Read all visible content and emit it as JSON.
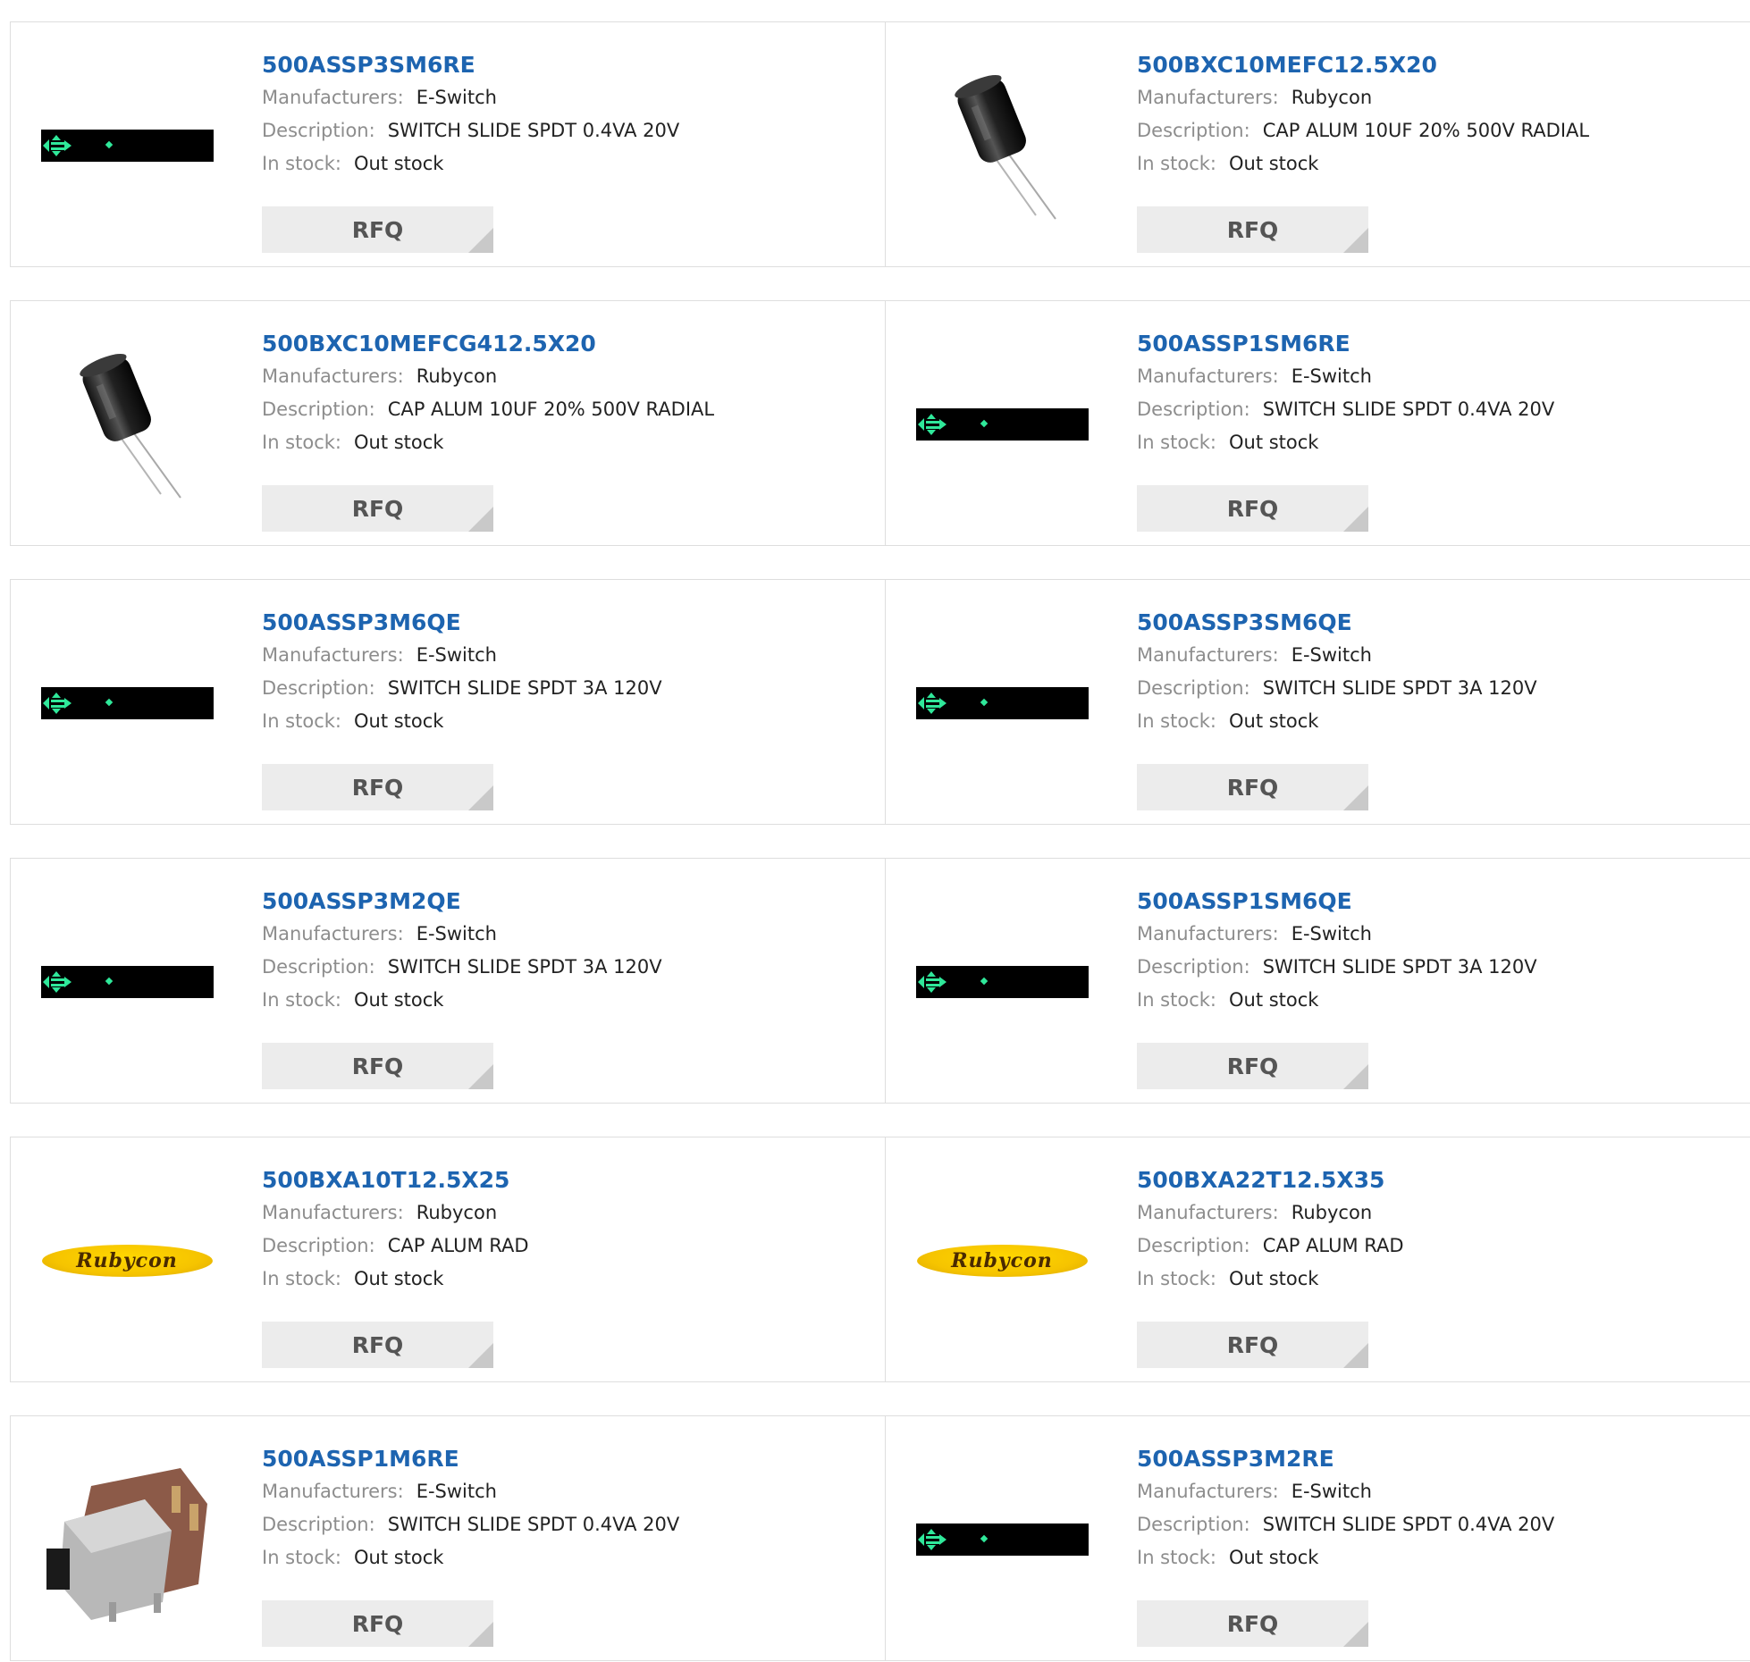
{
  "labels": {
    "manufacturers": "Manufacturers:",
    "description": "Description:",
    "in_stock": "In stock:",
    "rfq": "RFQ"
  },
  "colors": {
    "part_number": "#1d64b0",
    "label": "#8d8d8d",
    "button_bg": "#ececec",
    "border": "#dedede"
  },
  "products": [
    {
      "part": "500ASSP3SM6RE",
      "manufacturer": "E-Switch",
      "description": "SWITCH SLIDE SPDT 0.4VA 20V",
      "stock": "Out stock",
      "image": "switch-strip"
    },
    {
      "part": "500BXC10MEFC12.5X20",
      "manufacturer": "Rubycon",
      "description": "CAP ALUM 10UF 20% 500V RADIAL",
      "stock": "Out stock",
      "image": "capacitor"
    },
    {
      "part": "500BXC10MEFCG412.5X20",
      "manufacturer": "Rubycon",
      "description": "CAP ALUM 10UF 20% 500V RADIAL",
      "stock": "Out stock",
      "image": "capacitor"
    },
    {
      "part": "500ASSP1SM6RE",
      "manufacturer": "E-Switch",
      "description": "SWITCH SLIDE SPDT 0.4VA 20V",
      "stock": "Out stock",
      "image": "switch-strip"
    },
    {
      "part": "500ASSP3M6QE",
      "manufacturer": "E-Switch",
      "description": "SWITCH SLIDE SPDT 3A 120V",
      "stock": "Out stock",
      "image": "switch-strip"
    },
    {
      "part": "500ASSP3SM6QE",
      "manufacturer": "E-Switch",
      "description": "SWITCH SLIDE SPDT 3A 120V",
      "stock": "Out stock",
      "image": "switch-strip"
    },
    {
      "part": "500ASSP3M2QE",
      "manufacturer": "E-Switch",
      "description": "SWITCH SLIDE SPDT 3A 120V",
      "stock": "Out stock",
      "image": "switch-strip"
    },
    {
      "part": "500ASSP1SM6QE",
      "manufacturer": "E-Switch",
      "description": "SWITCH SLIDE SPDT 3A 120V",
      "stock": "Out stock",
      "image": "switch-strip"
    },
    {
      "part": "500BXA10T12.5X25",
      "manufacturer": "Rubycon",
      "description": "CAP ALUM RAD",
      "stock": "Out stock",
      "image": "rubycon-logo",
      "logo_text": "Rubycon"
    },
    {
      "part": "500BXA22T12.5X35",
      "manufacturer": "Rubycon",
      "description": "CAP ALUM RAD",
      "stock": "Out stock",
      "image": "rubycon-logo",
      "logo_text": "Rubycon"
    },
    {
      "part": "500ASSP1M6RE",
      "manufacturer": "E-Switch",
      "description": "SWITCH SLIDE SPDT 0.4VA 20V",
      "stock": "Out stock",
      "image": "slide-switch"
    },
    {
      "part": "500ASSP3M2RE",
      "manufacturer": "E-Switch",
      "description": "SWITCH SLIDE SPDT 0.4VA 20V",
      "stock": "Out stock",
      "image": "switch-strip"
    }
  ]
}
